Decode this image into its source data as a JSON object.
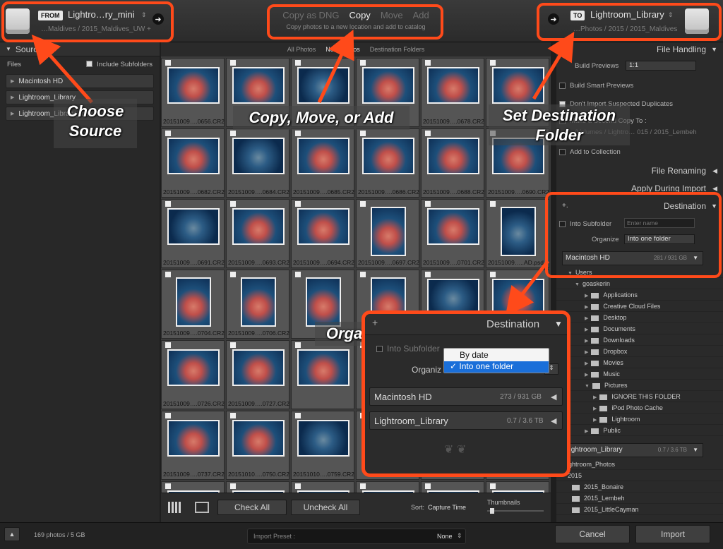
{
  "top": {
    "from_tag": "FROM",
    "from_name": "Lightro…ry_mini",
    "from_path": "…Maldives / 2015_Maldives_UW +",
    "modes": [
      "Copy as DNG",
      "Copy",
      "Move",
      "Add"
    ],
    "active_mode": "Copy",
    "mode_desc": "Copy photos to a new location and add to catalog",
    "to_tag": "TO",
    "to_name": "Lightroom_Library",
    "to_path": "…Photos / 2015 / 2015_Maldives"
  },
  "source": {
    "title": "Source",
    "files_label": "Files",
    "include_subfolders": "Include Subfolders",
    "items": [
      "Macintosh HD",
      "Lightroom_Library",
      "Lightroom_Library_mini"
    ]
  },
  "grid_tabs": [
    "All Photos",
    "New Photos",
    "Destination Folders"
  ],
  "grid_files": [
    "20151009….0656.CR2",
    "",
    "",
    "",
    "20151009….0678.CR2",
    "",
    "20151009….0682.CR2",
    "20151009….0684.CR2",
    "20151009….0685.CR2",
    "20151009….0686.CR2",
    "20151009….0688.CR2",
    "20151009….0690.CR2",
    "20151009….0691.CR2",
    "20151009….0693.CR2",
    "20151009….0694.CR2",
    "20151009….0697.CR2",
    "20151009….0701.CR2",
    "20151009…..AD.psd",
    "20151009….0704.CR2",
    "20151009….0706.CR2",
    "",
    "",
    "",
    "",
    "20151009….0726.CR2",
    "20151009….0727.CR2",
    "",
    "",
    "",
    "",
    "20151009….0737.CR2",
    "20151010….0750.CR2",
    "20151010….0759.CR2",
    "",
    "",
    ""
  ],
  "grid_bottom": {
    "check_all": "Check All",
    "uncheck_all": "Uncheck All",
    "sort_label": "Sort:",
    "sort_value": "Capture Time",
    "thumbnails": "Thumbnails"
  },
  "right": {
    "file_handling": "File Handling",
    "build_previews_label": "Build Previews",
    "build_previews_value": "1:1",
    "build_smart": "Build Smart Previews",
    "dont_import": "Don't Import Suspected Duplicates",
    "copy_to": "Make a Second Copy To :",
    "copy_to_path": "/Volumes / Lightro… 015 / 2015_Lembeh",
    "add_collection": "Add to Collection",
    "file_renaming": "File Renaming",
    "apply_during": "Apply During Import",
    "destination": "Destination",
    "plus": "+.",
    "into_subfolder": "Into Subfolder",
    "subfolder_placeholder": "Enter name",
    "organize_label": "Organize",
    "organize_value": "Into one folder",
    "disk_name": "Macintosh HD",
    "disk_size": "281 / 931 GB",
    "tree": [
      "Users",
      "goaskerin",
      "Applications",
      "Creative Cloud Files",
      "Desktop",
      "Documents",
      "Downloads",
      "Dropbox",
      "Movies",
      "Music",
      "Pictures",
      "IGNORE THIS FOLDER",
      "iPod Photo Cache",
      "Lightroom",
      "Public"
    ],
    "lib_name": "Lightroom_Library",
    "lib_size": "0.7 / 3.6 TB",
    "lib_tree": [
      "Lightroom_Photos",
      "2015",
      "2015_Bonaire",
      "2015_Lembeh",
      "2015_LittleCayman"
    ]
  },
  "footer": {
    "count": "169 photos / 5 GB",
    "preset_label": "Import Preset :",
    "preset_value": "None",
    "cancel": "Cancel",
    "import": "Import"
  },
  "zoom": {
    "plus": "+",
    "title": "Destination",
    "into_subfolder": "Into Subfolder",
    "organize": "Organiz",
    "menu_options": [
      "By date",
      "Into one folder"
    ],
    "selected": "Into one folder",
    "disk1": "Macintosh HD",
    "disk1_size": "273 / 931 GB",
    "disk2": "Lightroom_Library",
    "disk2_size": "0.7 / 3.6 TB"
  },
  "annotations": {
    "choose_source": "Choose\nSource",
    "copy_move": "Copy, Move, or Add",
    "set_dest": "Set Destination\nFolder",
    "organize": "Organize"
  },
  "colors": {
    "callout": "#ff4a1a",
    "selected": "#1a6fd9"
  }
}
